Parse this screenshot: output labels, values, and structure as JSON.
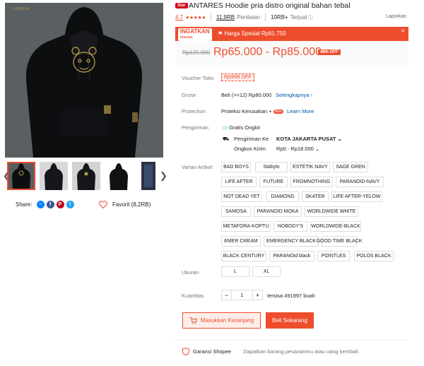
{
  "gallery": {
    "brand_mark": "SAMOVA",
    "thumbnail_count": 5
  },
  "share": {
    "label": "Share:",
    "icons": [
      "messenger-icon",
      "facebook-icon",
      "pinterest-icon",
      "twitter-icon"
    ]
  },
  "favorite": {
    "label": "Favorit (8,2RB)"
  },
  "product": {
    "badge": "Star",
    "title": "ANTARES Hoodie pria distro original bahan tebal",
    "rating": "4.7",
    "stars": "★★★★★",
    "ratings_count": "11,9RB",
    "ratings_label": "Penilaian",
    "sold_count": "10RB+",
    "sold_label": "Terjual",
    "report": "Laporkan"
  },
  "promo": {
    "logo_top": "INGATKAN",
    "logo_bottom": "DISKON",
    "text": "Harga Spesial Rp61.750",
    "close": "✕"
  },
  "price": {
    "old": "Rp125.000",
    "current": "Rp65.000 - Rp85.000",
    "discount": "48% OFF"
  },
  "voucher": {
    "label": "Voucher Toko",
    "value": "Rp5RB OFF"
  },
  "grosir": {
    "label": "Grosir",
    "value": "Beli (>=12) Rp80.000",
    "link": "Selengkapnya"
  },
  "protection": {
    "label": "Protection",
    "value": "Proteksi Kerusakan +",
    "badge": "New",
    "link": "Learn More"
  },
  "shipping": {
    "label": "Pengiriman",
    "free": "Gratis Ongkir",
    "to_label": "Pengiriman Ke",
    "to_value": "KOTA JAKARTA PUSAT",
    "cost_label": "Ongkos Kirim",
    "cost_value": "Rp0 - Rp18.000"
  },
  "variants": {
    "label": "Varian Artikel",
    "options": [
      "BAD BOYS",
      "Stabylo",
      "ESTETIK NAVY",
      "SAGE GREN",
      "LIFE AFTER",
      "FUTURE",
      "FROMNOTHING",
      "PARANOID-NAVY",
      "NOT DEAD YET",
      "DIAMOND",
      "SKATER",
      "LIFE AFTER-YELOW",
      "SAMOSA",
      "PARANOID MOKA",
      "WORLDWIDE WHITE",
      "METAFORA-KOPTU",
      "NOBODY'S",
      "WORLDWIDE-BLACK",
      "EMER CREAM",
      "EMERGENCY BLACK",
      "GOOD TIME BLACK",
      "BLACK CENTURY",
      "PARANOid black",
      "POINTLES",
      "POLOS BLACK"
    ]
  },
  "sizes": {
    "label": "Ukuran",
    "options": [
      "L",
      "XL"
    ]
  },
  "quantity": {
    "label": "Kuantitas",
    "minus": "−",
    "value": "1",
    "plus": "+",
    "stock": "tersisa 491997 buah"
  },
  "actions": {
    "cart": "Masukkan Keranjang",
    "buy": "Beli Sekarang"
  },
  "guarantee": {
    "title": "Garansi Shopee",
    "text": "Dapatkan barang pesananmu atau uang kembali."
  },
  "colors": {
    "accent": "#ee4d2d",
    "link": "#0055aa",
    "background": "#ffffff"
  }
}
